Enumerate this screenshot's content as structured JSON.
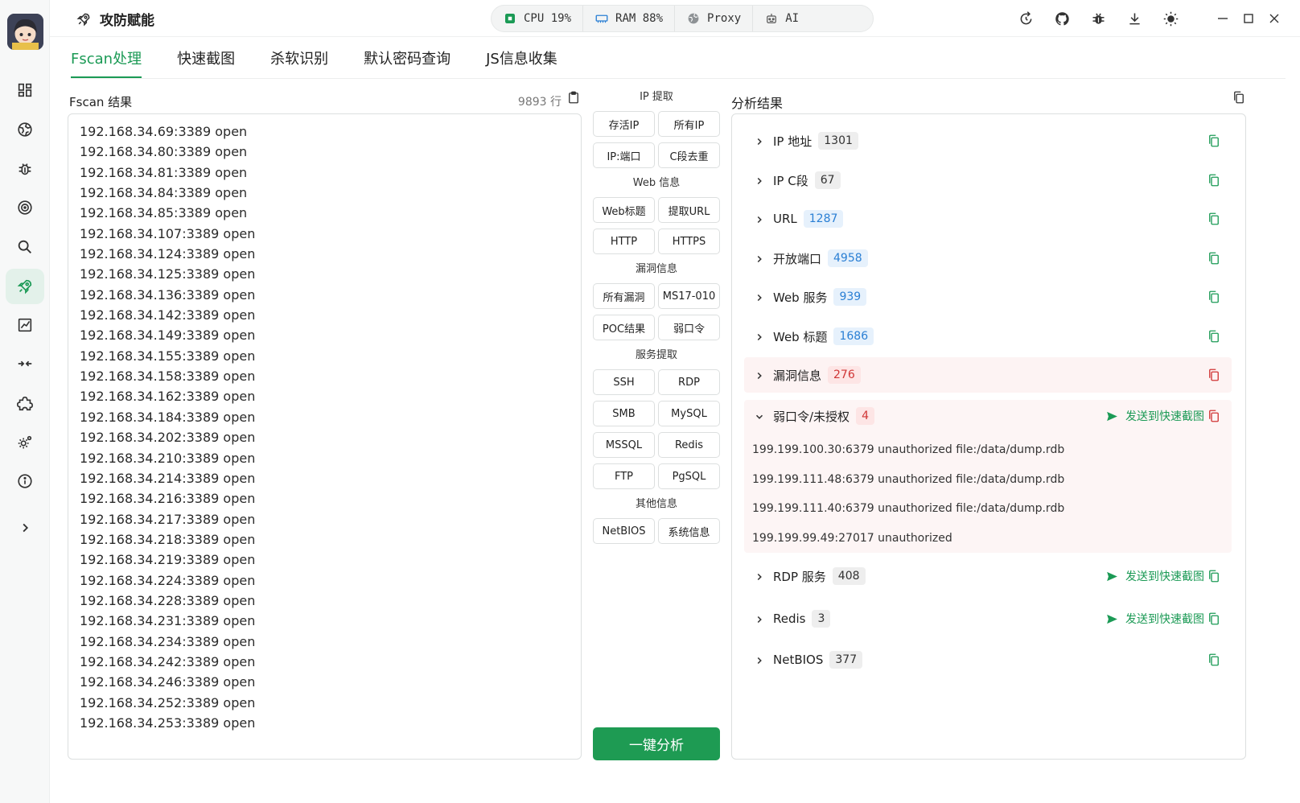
{
  "app": {
    "title": "攻防赋能"
  },
  "status": {
    "cpu": "CPU 19%",
    "ram": "RAM 88%",
    "proxy": "Proxy",
    "ai": "AI"
  },
  "tabs": [
    {
      "label": "Fscan处理",
      "active": true
    },
    {
      "label": "快速截图"
    },
    {
      "label": "杀软识别"
    },
    {
      "label": "默认密码查询"
    },
    {
      "label": "JS信息收集"
    }
  ],
  "fscan": {
    "title": "Fscan 结果",
    "line_count": "9893 行",
    "lines": [
      "192.168.34.69:3389 open",
      "192.168.34.80:3389 open",
      "192.168.34.81:3389 open",
      "192.168.34.84:3389 open",
      "192.168.34.85:3389 open",
      "192.168.34.107:3389 open",
      "192.168.34.124:3389 open",
      "192.168.34.125:3389 open",
      "192.168.34.136:3389 open",
      "192.168.34.142:3389 open",
      "192.168.34.149:3389 open",
      "192.168.34.155:3389 open",
      "192.168.34.158:3389 open",
      "192.168.34.162:3389 open",
      "192.168.34.184:3389 open",
      "192.168.34.202:3389 open",
      "192.168.34.210:3389 open",
      "192.168.34.214:3389 open",
      "192.168.34.216:3389 open",
      "192.168.34.217:3389 open",
      "192.168.34.218:3389 open",
      "192.168.34.219:3389 open",
      "192.168.34.224:3389 open",
      "192.168.34.228:3389 open",
      "192.168.34.231:3389 open",
      "192.168.34.234:3389 open",
      "192.168.34.242:3389 open",
      "192.168.34.246:3389 open",
      "192.168.34.252:3389 open",
      "192.168.34.253:3389 open"
    ]
  },
  "groups": [
    {
      "title": "IP 提取",
      "buttons": [
        "存活IP",
        "所有IP",
        "IP:端口",
        "C段去重"
      ]
    },
    {
      "title": "Web 信息",
      "buttons": [
        "Web标题",
        "提取URL",
        "HTTP",
        "HTTPS"
      ]
    },
    {
      "title": "漏洞信息",
      "buttons": [
        "所有漏洞",
        "MS17-010",
        "POC结果",
        "弱口令"
      ]
    },
    {
      "title": "服务提取",
      "buttons": [
        "SSH",
        "RDP",
        "SMB",
        "MySQL",
        "MSSQL",
        "Redis",
        "FTP",
        "PgSQL"
      ]
    },
    {
      "title": "其他信息",
      "buttons": [
        "NetBIOS",
        "系统信息"
      ]
    }
  ],
  "analyze_button": "一键分析",
  "analysis": {
    "title": "分析结果",
    "send_label": "发送到快速截图",
    "rows": [
      {
        "label": "IP 地址",
        "count": "1301",
        "style": "gray"
      },
      {
        "label": "IP C段",
        "count": "67",
        "style": "gray"
      },
      {
        "label": "URL",
        "count": "1287",
        "style": "blue"
      },
      {
        "label": "开放端口",
        "count": "4958",
        "style": "blue"
      },
      {
        "label": "Web 服务",
        "count": "939",
        "style": "blue"
      },
      {
        "label": "Web 标题",
        "count": "1686",
        "style": "blue"
      },
      {
        "label": "漏洞信息",
        "count": "276",
        "style": "red"
      },
      {
        "label": "弱口令/未授权",
        "count": "4",
        "style": "red"
      },
      {
        "label": "RDP 服务",
        "count": "408",
        "style": "gray"
      },
      {
        "label": "Redis",
        "count": "3",
        "style": "gray"
      },
      {
        "label": "NetBIOS",
        "count": "377",
        "style": "gray"
      }
    ],
    "weak_details": [
      "199.199.100.30:6379 unauthorized file:/data/dump.rdb",
      "199.199.111.48:6379 unauthorized file:/data/dump.rdb",
      "199.199.111.40:6379 unauthorized file:/data/dump.rdb",
      "199.199.99.49:27017 unauthorized"
    ]
  },
  "colors": {
    "accent": "#1b9a55",
    "blue": "#2a7fd4",
    "red": "#d03535"
  }
}
